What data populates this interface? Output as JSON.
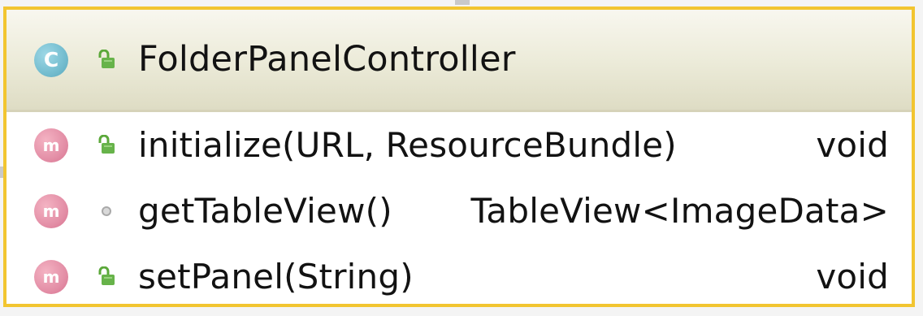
{
  "class_box": {
    "name": "FolderPanelController",
    "kind_badge": "C",
    "kind_icon": "class-icon",
    "visibility_icon": "public-lock-icon",
    "members": [
      {
        "kind_badge": "m",
        "kind_icon": "method-icon",
        "visibility_icon": "public-lock-icon",
        "name": "initialize(URL, ResourceBundle)",
        "type": "void"
      },
      {
        "kind_badge": "m",
        "kind_icon": "method-icon",
        "visibility_icon": "package-private-icon",
        "name": "getTableView()",
        "type": "TableView<ImageData>"
      },
      {
        "kind_badge": "m",
        "kind_icon": "method-icon",
        "visibility_icon": "public-lock-icon",
        "name": "setPanel(String)",
        "type": "void"
      }
    ]
  },
  "colors": {
    "class_border": "#f2c530",
    "header_fill": "#ecebd9",
    "class_badge": "#77bfd1",
    "method_badge": "#e38ea6",
    "public_visibility": "#5ba83a"
  }
}
